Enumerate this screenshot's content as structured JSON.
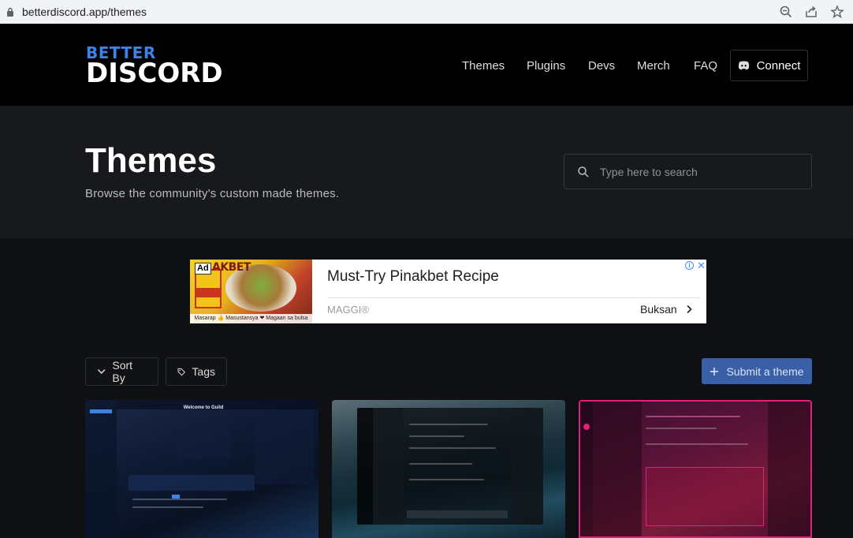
{
  "browser": {
    "url": "betterdiscord.app/themes",
    "icons": [
      "lock-icon",
      "zoom-icon",
      "share-icon",
      "bookmark-star-icon"
    ]
  },
  "header": {
    "logo_top": "BETTER",
    "logo_bottom": "DISCORD",
    "nav": [
      "Themes",
      "Plugins",
      "Devs",
      "Merch",
      "FAQ"
    ],
    "connect_label": "Connect"
  },
  "hero": {
    "title": "Themes",
    "subtitle": "Browse the community's custom made themes.",
    "search_placeholder": "Type here to search"
  },
  "ad": {
    "badge": "Ad",
    "brand_word": "AKBET",
    "caption": "Masarap 👍 Masustansya ❤ Magaan sa bulsa",
    "headline": "Must-Try Pinakbet Recipe",
    "advertiser": "MAGGI®",
    "cta": "Buksan"
  },
  "toolbar": {
    "sort_label": "Sort By",
    "tags_label": "Tags",
    "submit_label": "Submit a theme"
  },
  "cards": [
    {
      "name": "theme-card",
      "card_title": "Welcome to Guild"
    },
    {
      "name": "theme-card"
    },
    {
      "name": "theme-card"
    }
  ],
  "colors": {
    "accent": "#3e82e5",
    "submit_bg": "#3b5fa6",
    "header_bg": "#000000",
    "hero_bg": "#18191c",
    "page_bg": "#0f1013"
  }
}
